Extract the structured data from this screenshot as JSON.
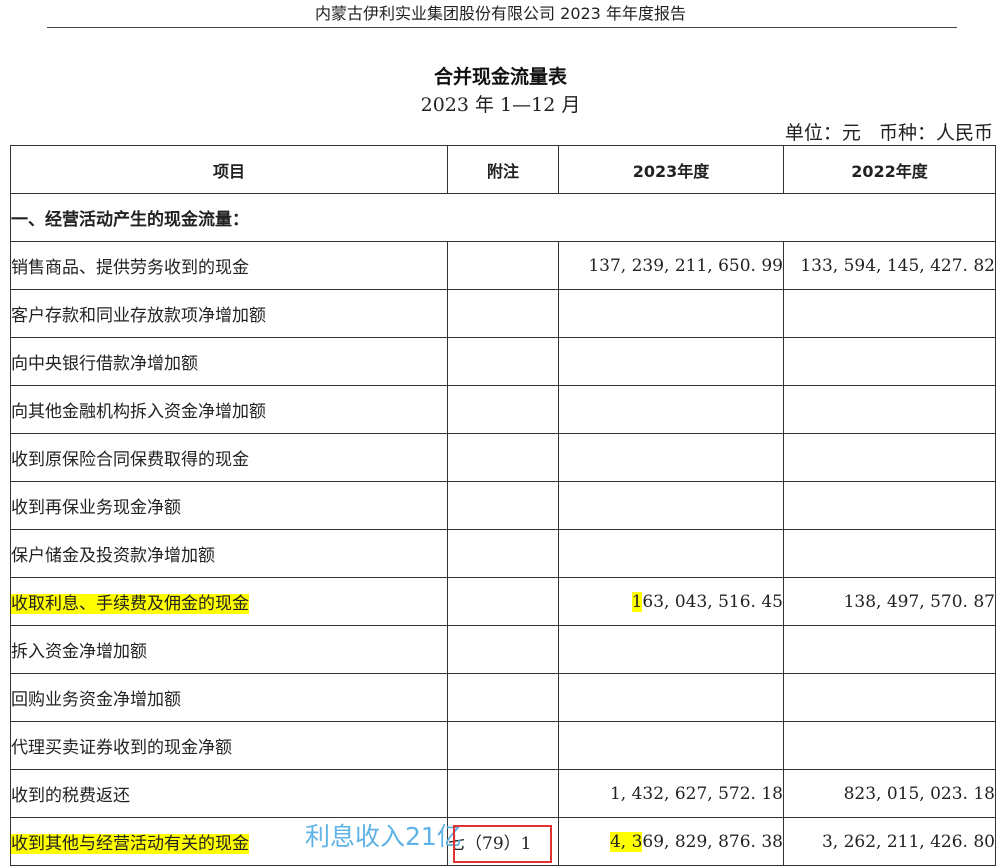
{
  "header": {
    "report_title": "内蒙古伊利实业集团股份有限公司 2023 年年度报告"
  },
  "statement": {
    "title": "合并现金流量表",
    "period": "2023 年 1—12 月",
    "unit_label": "单位：元",
    "currency_label": "币种：人民币"
  },
  "table": {
    "columns": [
      "项目",
      "附注",
      "2023年度",
      "2022年度"
    ],
    "section_header": "一、经营活动产生的现金流量：",
    "rows": [
      {
        "item": "销售商品、提供劳务收到的现金",
        "note": "",
        "y2023": "137, 239, 211, 650. 99",
        "y2022": "133, 594, 145, 427. 82"
      },
      {
        "item": "客户存款和同业存放款项净增加额",
        "note": "",
        "y2023": "",
        "y2022": ""
      },
      {
        "item": "向中央银行借款净增加额",
        "note": "",
        "y2023": "",
        "y2022": ""
      },
      {
        "item": "向其他金融机构拆入资金净增加额",
        "note": "",
        "y2023": "",
        "y2022": ""
      },
      {
        "item": "收到原保险合同保费取得的现金",
        "note": "",
        "y2023": "",
        "y2022": ""
      },
      {
        "item": "收到再保业务现金净额",
        "note": "",
        "y2023": "",
        "y2022": ""
      },
      {
        "item": "保户储金及投资款净增加额",
        "note": "",
        "y2023": "",
        "y2022": ""
      },
      {
        "item": "收取利息、手续费及佣金的现金",
        "note": "",
        "y2023_hl": "1",
        "y2023_rest": "63, 043, 516. 45",
        "y2022": "138, 497, 570. 87"
      },
      {
        "item": "拆入资金净增加额",
        "note": "",
        "y2023": "",
        "y2022": ""
      },
      {
        "item": "回购业务资金净增加额",
        "note": "",
        "y2023": "",
        "y2022": ""
      },
      {
        "item": "代理买卖证券收到的现金净额",
        "note": "",
        "y2023": "",
        "y2022": ""
      },
      {
        "item": "收到的税费返还",
        "note": "",
        "y2023": "1, 432, 627, 572. 18",
        "y2022": "823, 015, 023. 18"
      },
      {
        "item": "收到其他与经营活动有关的现金",
        "note": "七（79）1",
        "y2023_hl": "4, 3",
        "y2023_rest": "69, 829, 876. 38",
        "y2022": "3, 262, 211, 426. 80"
      }
    ]
  },
  "annotation": {
    "text": "利息收入21亿",
    "text_color": "#5fb3e6",
    "box_color": "#e23232",
    "highlight_color": "#ffff00"
  }
}
